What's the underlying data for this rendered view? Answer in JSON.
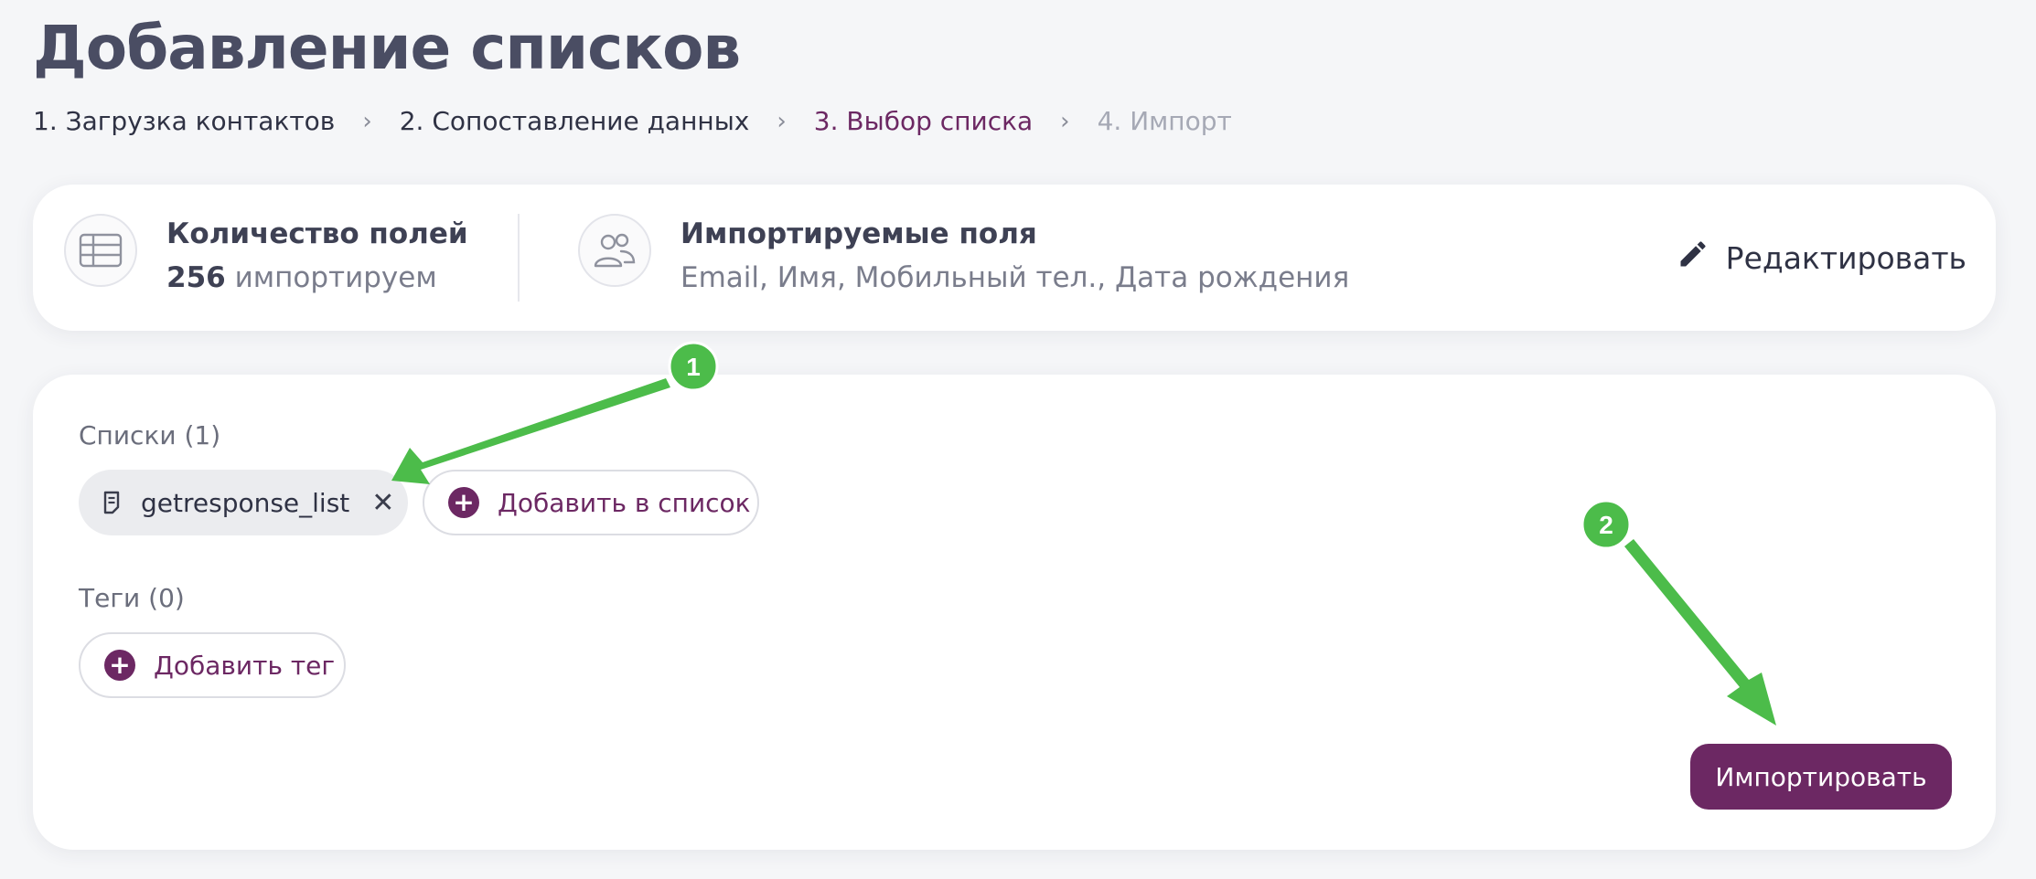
{
  "page": {
    "title": "Добавление списков"
  },
  "breadcrumb": {
    "steps": [
      {
        "label": "1. Загрузка контактов",
        "state": "done"
      },
      {
        "label": "2. Сопоставление данных",
        "state": "done"
      },
      {
        "label": "3. Выбор списка",
        "state": "active"
      },
      {
        "label": "4. Импорт",
        "state": "disabled"
      }
    ]
  },
  "summary": {
    "fields_count_title": "Количество полей",
    "fields_count_number": "256",
    "fields_count_suffix": "импортируем",
    "imported_fields_title": "Импортируемые поля",
    "imported_fields_value": "Email, Имя, Мобильный тел., Дата рождения",
    "edit_label": "Редактировать"
  },
  "lists": {
    "label": "Списки (1)",
    "items": [
      {
        "name": "getresponse_list"
      }
    ],
    "add_label": "Добавить в список"
  },
  "tags": {
    "label": "Теги (0)",
    "add_label": "Добавить тег"
  },
  "actions": {
    "import_label": "Импортировать"
  },
  "annotations": {
    "marker_1": "1",
    "marker_2": "2",
    "color": "#4cbc4a"
  },
  "colors": {
    "accent": "#6c2863",
    "background": "#f5f6f8",
    "card": "#ffffff"
  }
}
